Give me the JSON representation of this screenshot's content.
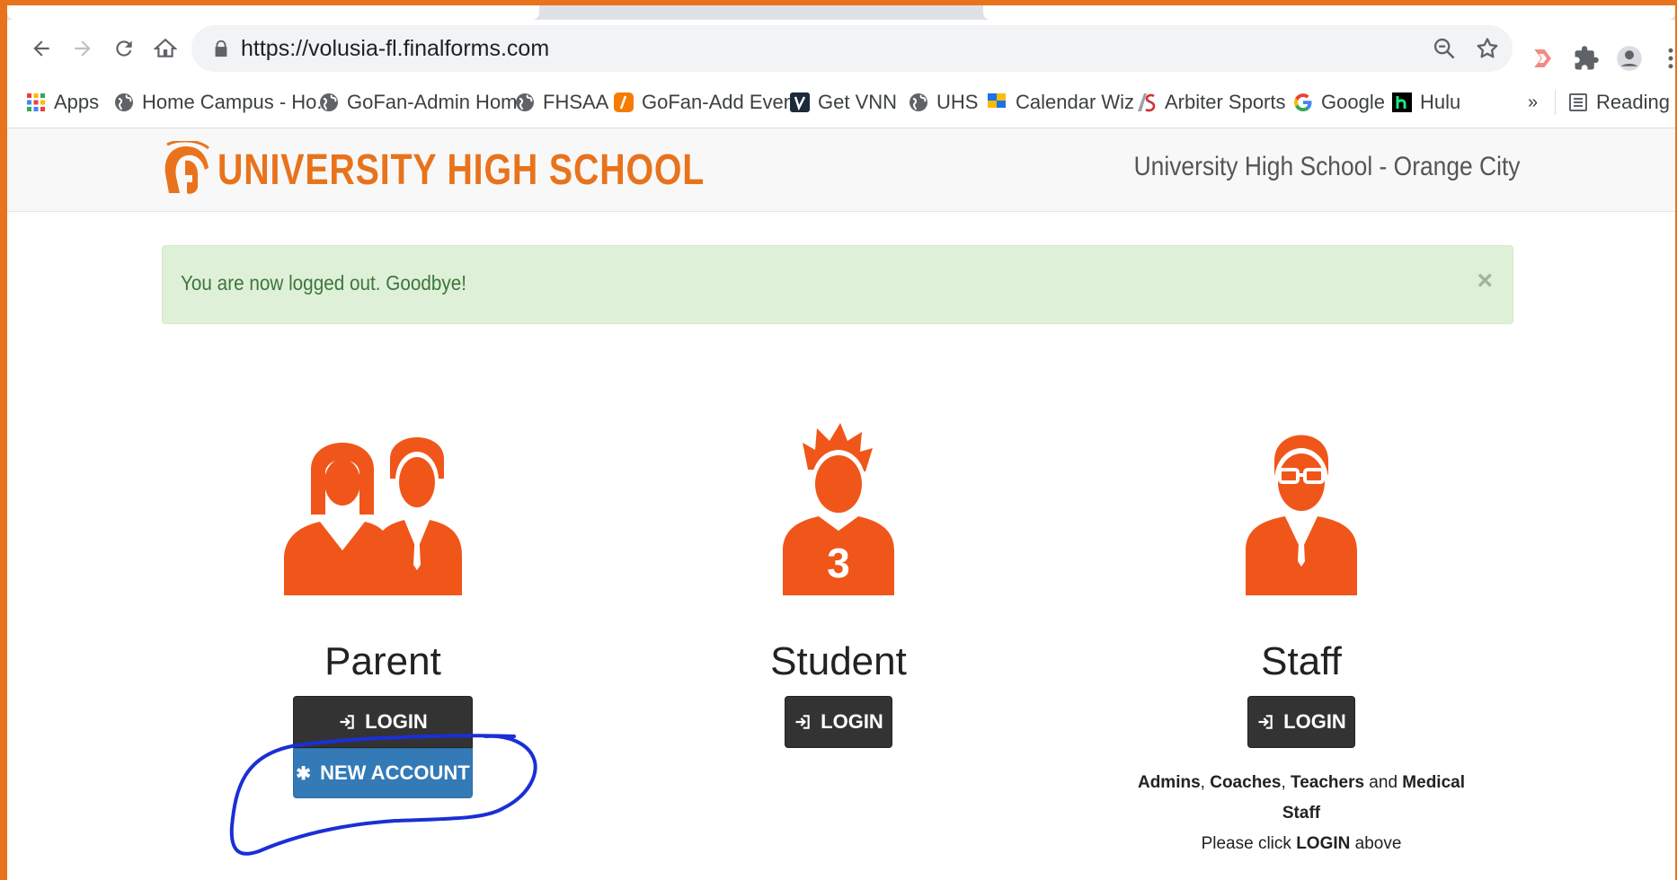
{
  "browser": {
    "url": "https://volusia-fl.finalforms.com",
    "bookmarks": [
      {
        "label": "Apps",
        "icon": "apps-grid-icon"
      },
      {
        "label": "Home Campus - Ho...",
        "icon": "globe-icon"
      },
      {
        "label": "GoFan-Admin Home",
        "icon": "globe-icon"
      },
      {
        "label": "FHSAA",
        "icon": "globe-icon"
      },
      {
        "label": "GoFan-Add Event",
        "icon": "gofan-icon"
      },
      {
        "label": "Get VNN",
        "icon": "vnn-icon"
      },
      {
        "label": "UHS",
        "icon": "globe-icon"
      },
      {
        "label": "Calendar Wiz",
        "icon": "calendarwiz-icon"
      },
      {
        "label": "Arbiter Sports",
        "icon": "arbiter-icon"
      },
      {
        "label": "Google",
        "icon": "google-icon"
      },
      {
        "label": "Hulu",
        "icon": "hulu-icon"
      }
    ],
    "overflow_label": "»",
    "reading_list_label": "Reading lis"
  },
  "site": {
    "logo_text": "UNIVERSITY HIGH SCHOOL",
    "name": "University High School - Orange City"
  },
  "alert": {
    "message": "You are now logged out. Goodbye!",
    "close_label": "×"
  },
  "roles": {
    "parent": {
      "title": "Parent",
      "login_label": "LOGIN",
      "new_account_label": "NEW ACCOUNT"
    },
    "student": {
      "title": "Student",
      "login_label": "LOGIN",
      "jersey_number": "3"
    },
    "staff": {
      "title": "Staff",
      "login_label": "LOGIN",
      "note_1": "Admins",
      "note_sep_1": ", ",
      "note_2": "Coaches",
      "note_sep_2": ", ",
      "note_3": "Teachers",
      "note_and": " and ",
      "note_4": "Medical Staff",
      "note_line2_pre": "Please click ",
      "note_line2_bold": "LOGIN",
      "note_line2_post": " above"
    }
  },
  "colors": {
    "brand_orange": "#e8731c",
    "alert_bg": "#dff0d8",
    "alert_text": "#3c763d",
    "login_btn": "#333333",
    "new_account_btn": "#337ab7",
    "annotation": "#1a2fd6"
  }
}
